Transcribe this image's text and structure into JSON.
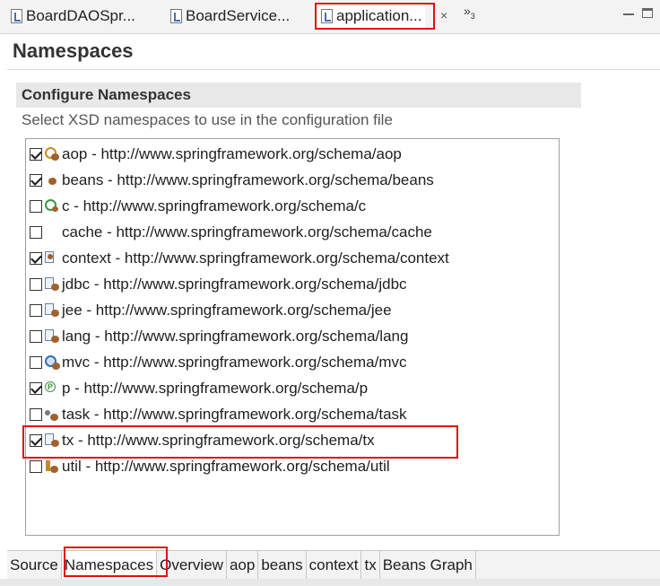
{
  "editor_tabs": [
    {
      "label": "BoardDAOSpr...",
      "active": false
    },
    {
      "label": "BoardService...",
      "active": false
    },
    {
      "label": "application...",
      "active": true,
      "close": "×"
    }
  ],
  "overflow": {
    "label": "»",
    "count": "3"
  },
  "page_title": "Namespaces",
  "section": {
    "title": "Configure Namespaces",
    "description": "Select XSD namespaces to use in the configuration file"
  },
  "namespaces": [
    {
      "label": "aop - http://www.springframework.org/schema/aop",
      "checked": true,
      "icon": "aop-icon"
    },
    {
      "label": "beans - http://www.springframework.org/schema/beans",
      "checked": true,
      "icon": "bean-icon"
    },
    {
      "label": "c - http://www.springframework.org/schema/c",
      "checked": false,
      "icon": "c-namespace-icon"
    },
    {
      "label": "cache - http://www.springframework.org/schema/cache",
      "checked": false,
      "icon": "none"
    },
    {
      "label": "context - http://www.springframework.org/schema/context",
      "checked": true,
      "icon": "context-icon"
    },
    {
      "label": "jdbc - http://www.springframework.org/schema/jdbc",
      "checked": false,
      "icon": "jdbc-icon"
    },
    {
      "label": "jee - http://www.springframework.org/schema/jee",
      "checked": false,
      "icon": "jee-icon"
    },
    {
      "label": "lang - http://www.springframework.org/schema/lang",
      "checked": false,
      "icon": "lang-icon"
    },
    {
      "label": "mvc - http://www.springframework.org/schema/mvc",
      "checked": false,
      "icon": "mvc-icon"
    },
    {
      "label": "p - http://www.springframework.org/schema/p",
      "checked": true,
      "icon": "p-namespace-icon"
    },
    {
      "label": "task - http://www.springframework.org/schema/task",
      "checked": false,
      "icon": "task-icon"
    },
    {
      "label": "tx - http://www.springframework.org/schema/tx",
      "checked": true,
      "icon": "tx-icon"
    },
    {
      "label": "util - http://www.springframework.org/schema/util",
      "checked": false,
      "icon": "util-icon"
    }
  ],
  "bottom_tabs": [
    {
      "label": "Source",
      "active": false
    },
    {
      "label": "Namespaces",
      "active": true
    },
    {
      "label": "Overview",
      "active": false
    },
    {
      "label": "aop",
      "active": false
    },
    {
      "label": "beans",
      "active": false
    },
    {
      "label": "context",
      "active": false
    },
    {
      "label": "tx",
      "active": false
    },
    {
      "label": "Beans Graph",
      "active": false
    }
  ],
  "highlight_color": "#e01010"
}
